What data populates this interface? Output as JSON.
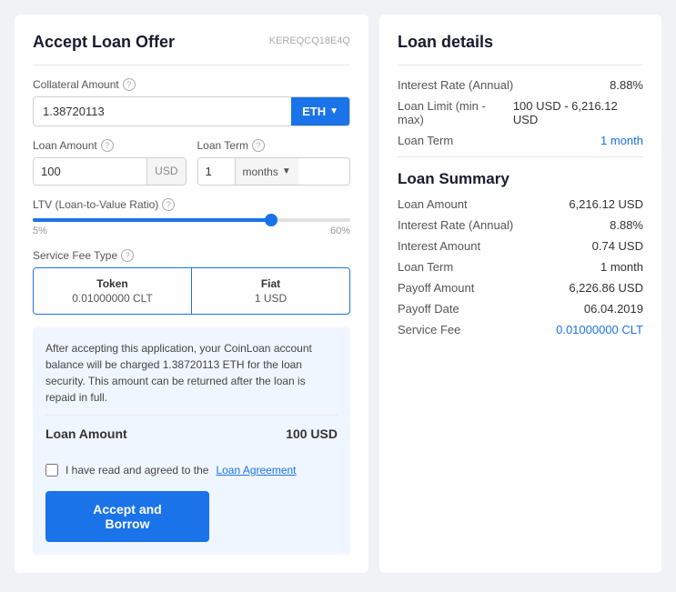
{
  "left": {
    "title": "Accept Loan Offer",
    "offer_id": "KEREQCQ18E4Q",
    "collateral": {
      "label": "Collateral Amount",
      "value": "1.38720113",
      "currency": "ETH"
    },
    "loan_amount": {
      "label": "Loan Amount",
      "value": "100",
      "currency": "USD"
    },
    "loan_term": {
      "label": "Loan Term",
      "value": "1",
      "unit": "months"
    },
    "ltv": {
      "label": "LTV (Loan-to-Value Ratio)",
      "min": "5%",
      "max": "60%"
    },
    "service_fee": {
      "label": "Service Fee Type",
      "token_label": "Token",
      "token_value": "0.01000000 CLT",
      "fiat_label": "Fiat",
      "fiat_value": "1 USD"
    },
    "info_text": "After accepting this application, your CoinLoan account balance will be charged 1.38720113 ETH for the loan security. This amount can be returned after the loan is repaid in full.",
    "summary_label": "Loan Amount",
    "summary_value": "100 USD",
    "agreement_text": "I have read and agreed to the",
    "agreement_link": "Loan Agreement",
    "accept_button": "Accept and Borrow"
  },
  "right": {
    "loan_details_title": "Loan details",
    "interest_rate_label": "Interest Rate (Annual)",
    "interest_rate_value": "8.88%",
    "loan_limit_label": "Loan Limit (min - max)",
    "loan_limit_value": "100 USD - 6,216.12 USD",
    "loan_term_label": "Loan Term",
    "loan_term_value": "1 month",
    "loan_summary_title": "Loan Summary",
    "summary_items": [
      {
        "label": "Loan Amount",
        "value": "6,216.12 USD",
        "blue": false
      },
      {
        "label": "Interest Rate (Annual)",
        "value": "8.88%",
        "blue": false
      },
      {
        "label": "Interest Amount",
        "value": "0.74 USD",
        "blue": false
      },
      {
        "label": "Loan Term",
        "value": "1 month",
        "blue": false
      },
      {
        "label": "Payoff Amount",
        "value": "6,226.86 USD",
        "blue": false
      },
      {
        "label": "Payoff Date",
        "value": "06.04.2019",
        "blue": false
      },
      {
        "label": "Service Fee",
        "value": "0.01000000 CLT",
        "blue": true
      }
    ]
  }
}
